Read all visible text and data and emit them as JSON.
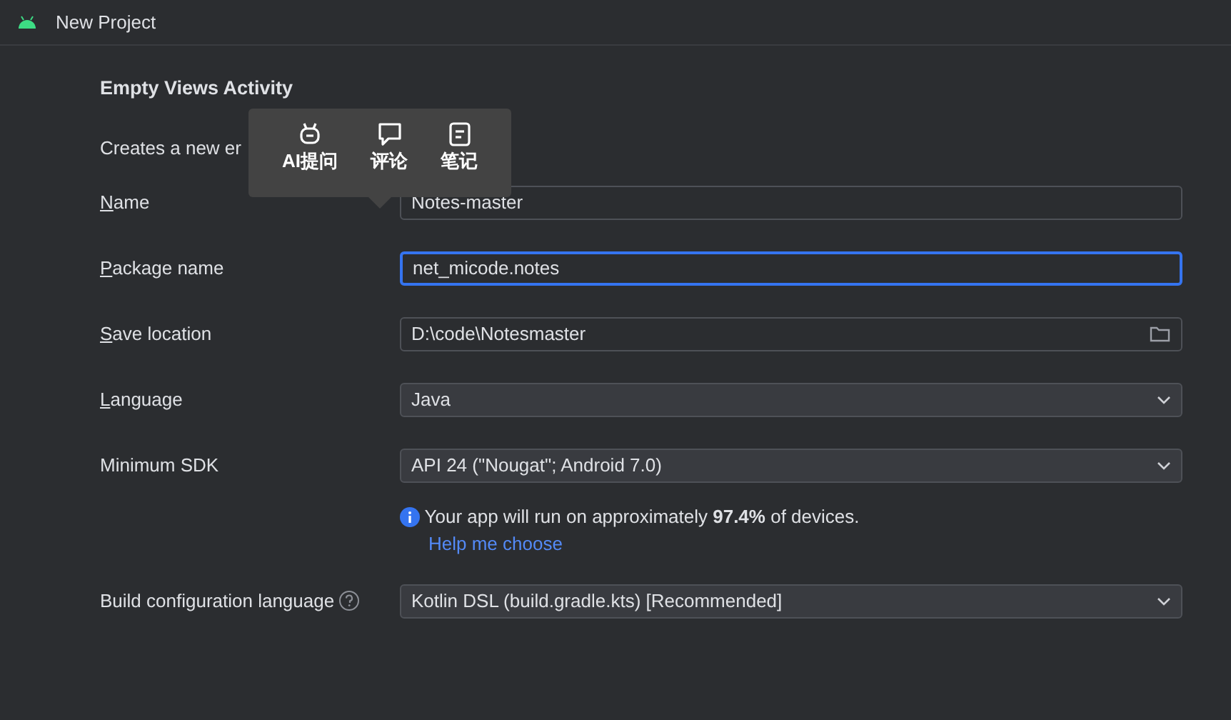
{
  "window": {
    "title": "New Project"
  },
  "heading": "Empty Views Activity",
  "description": "Creates a new er",
  "fields": [
    {
      "label": "Name",
      "underline_first": true,
      "kind": "text",
      "value": "Notes-master",
      "focused": false
    },
    {
      "label": "Package name",
      "underline_first": true,
      "kind": "text",
      "value": "net_micode.notes",
      "focused": true
    },
    {
      "label": "Save location",
      "underline_first": true,
      "kind": "folder",
      "value": "D:\\code\\Notesmaster",
      "focused": false
    },
    {
      "label": "Language",
      "underline_first": true,
      "kind": "dropdown",
      "value": "Java",
      "focused": false
    },
    {
      "label": "Minimum SDK",
      "underline_first": false,
      "kind": "dropdown",
      "value": "API 24 (\"Nougat\"; Android 7.0)",
      "focused": false
    }
  ],
  "info": {
    "text": "Your app will run on approximately **97.4%** of devices.",
    "link": "Help me choose"
  },
  "build_config": {
    "label": "Build configuration language",
    "value": "Kotlin DSL (build.gradle.kts) [Recommended]"
  },
  "popup": {
    "items": [
      {
        "kind": "robot",
        "label": "AI提问"
      },
      {
        "kind": "comment",
        "label": "评论"
      },
      {
        "kind": "note",
        "label": "笔记"
      }
    ]
  }
}
